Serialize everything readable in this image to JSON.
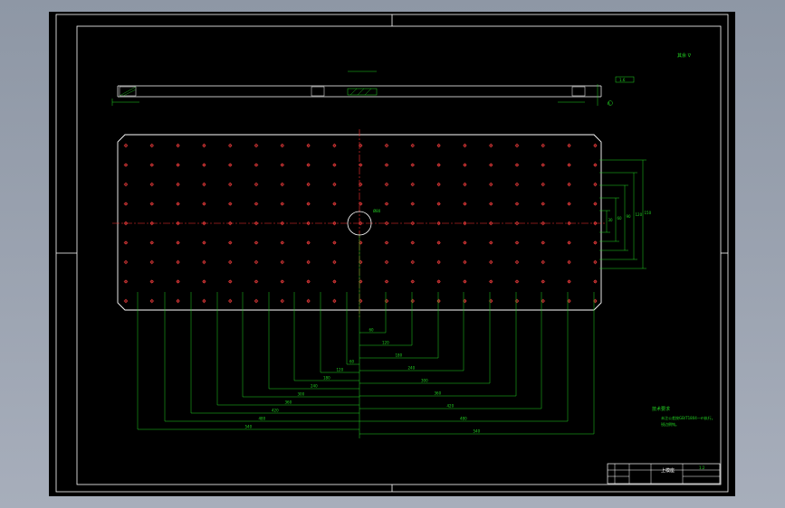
{
  "drawing": {
    "roughness_mark": "其余 ∇",
    "title_block": {
      "part_name": "上模座",
      "scale": "1:2"
    },
    "tech_notes": {
      "heading": "技术要求",
      "line1": "未注公差按GB/T1804—m执行。",
      "line2": "锐边倒钝。"
    },
    "section_labels": [
      "A",
      "A-A",
      "1.6"
    ],
    "center_hole": "Ø80",
    "bottom_dims_left": [
      "540",
      "480",
      "420",
      "360",
      "300",
      "240",
      "180",
      "120",
      "60",
      "0"
    ],
    "bottom_dims_right": [
      "60",
      "120",
      "180",
      "240",
      "300",
      "360",
      "420",
      "480",
      "540"
    ],
    "right_dims": [
      "30",
      "60",
      "90",
      "120",
      "150"
    ]
  },
  "colors": {
    "sheet": "#000000",
    "frame": "#ffffff",
    "dimension": "#22d422",
    "center_line": "#ff3030",
    "hole": "#ff4040"
  }
}
